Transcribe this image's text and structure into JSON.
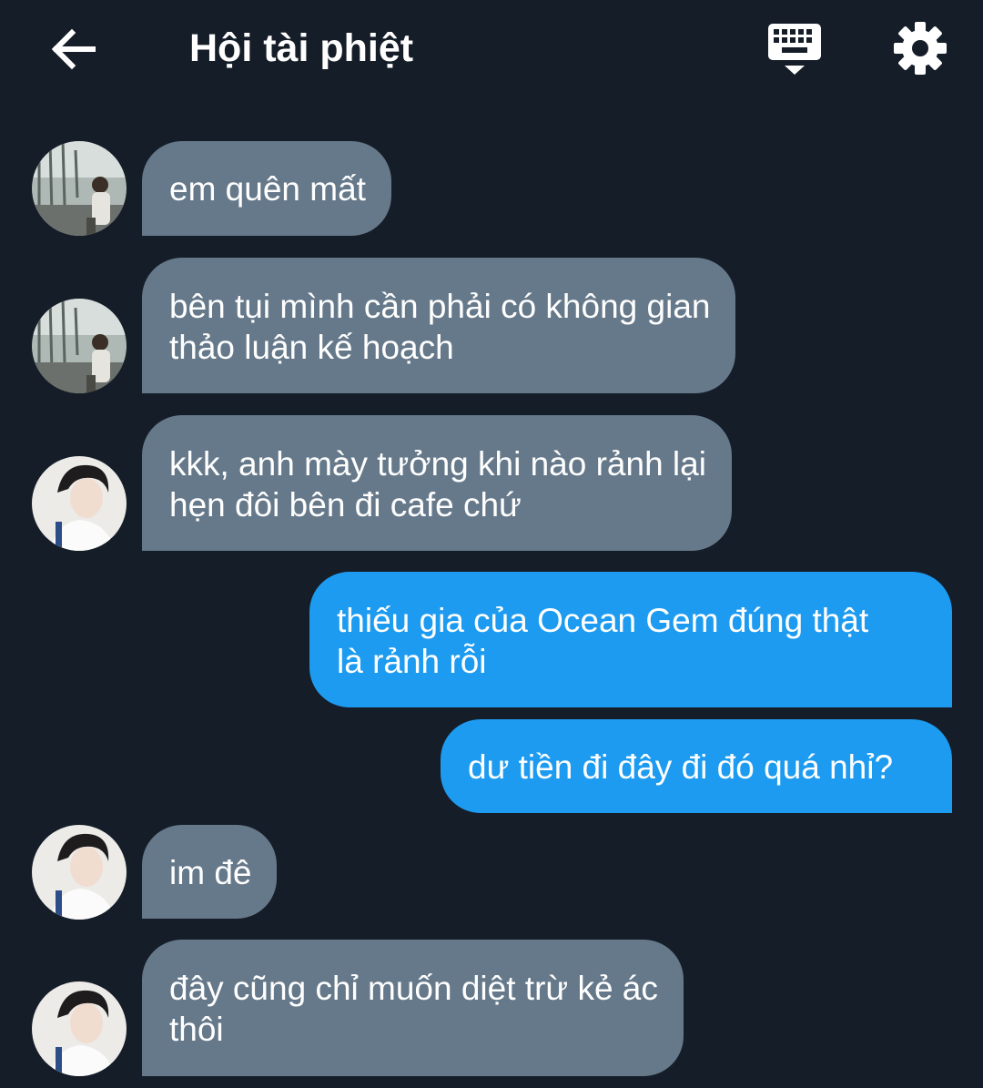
{
  "header": {
    "title": "Hội tài phiệt",
    "back_icon": "arrow-left-icon",
    "keyboard_icon": "keyboard-icon",
    "settings_icon": "gear-icon"
  },
  "colors": {
    "background": "#151d28",
    "incoming_bubble": "#66798a",
    "outgoing_bubble": "#1d9bf0",
    "text": "#ffffff"
  },
  "messages": [
    {
      "direction": "incoming",
      "sender_avatar": "avatar-airport",
      "lines": [
        "em quên mất"
      ]
    },
    {
      "direction": "incoming",
      "sender_avatar": "avatar-airport",
      "lines": [
        "bên tụi mình cần phải có không gian",
        "thảo luận kế hoạch"
      ]
    },
    {
      "direction": "incoming",
      "sender_avatar": "avatar-portrait",
      "lines": [
        "kkk, anh mày tưởng khi nào rảnh lại",
        "hẹn đôi bên đi cafe chứ"
      ]
    },
    {
      "direction": "outgoing",
      "lines": [
        "thiếu gia của Ocean Gem đúng thật",
        "là rảnh rỗi"
      ]
    },
    {
      "direction": "outgoing",
      "lines": [
        "dư tiền đi đây đi đó quá nhỉ?"
      ]
    },
    {
      "direction": "incoming",
      "sender_avatar": "avatar-portrait",
      "lines": [
        "im đê"
      ]
    },
    {
      "direction": "incoming",
      "sender_avatar": "avatar-portrait",
      "lines": [
        "đây cũng chỉ muốn diệt trừ kẻ ác",
        "thôi"
      ]
    }
  ]
}
